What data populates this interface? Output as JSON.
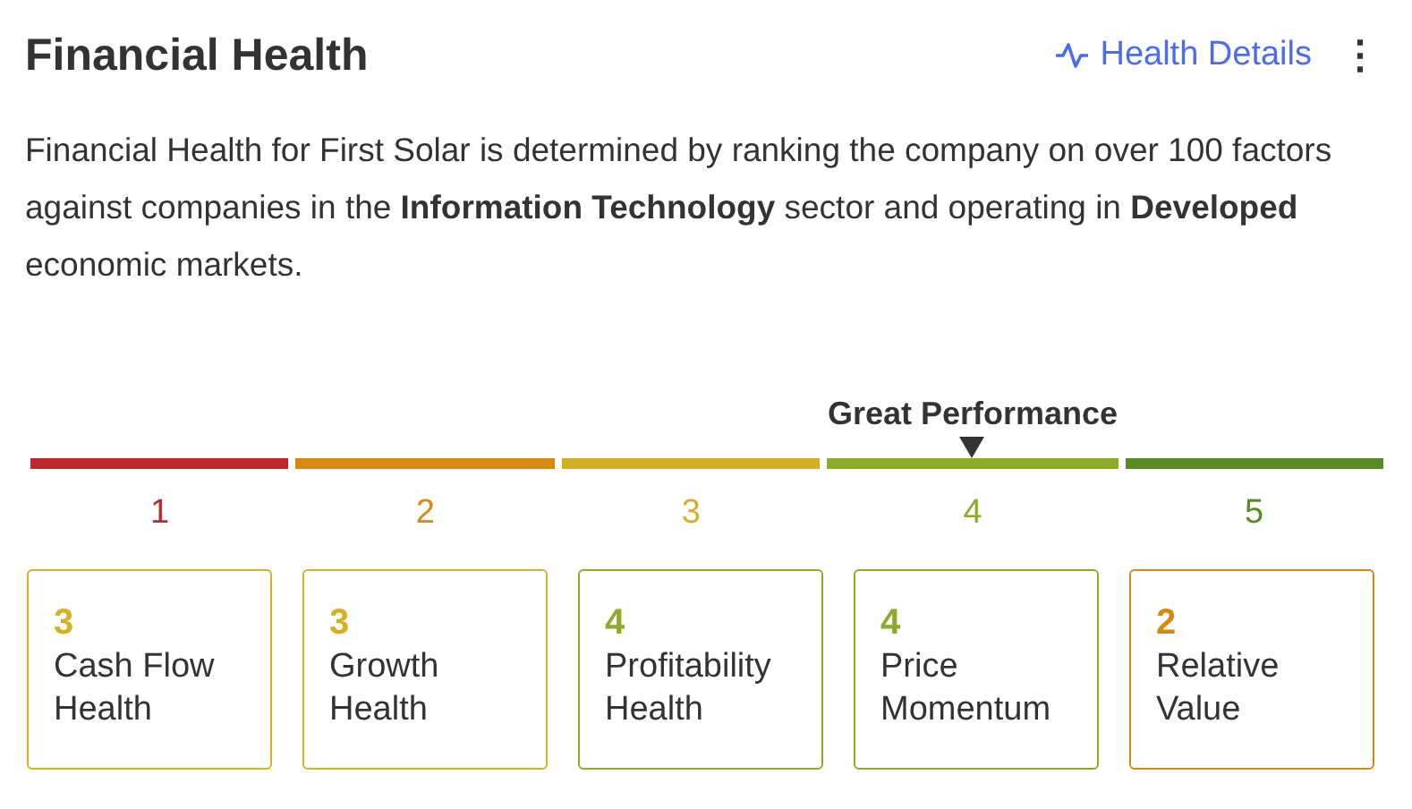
{
  "title": "Financial Health",
  "details_link": "Health Details",
  "menu_icon": "⋮",
  "description": "Financial Health for First Solar is determined by ranking the company on over 100 factors against companies in the **Information Technology** sector and operating in **Developed** economic markets.",
  "scale": [
    {
      "label": "1",
      "selected": false
    },
    {
      "label": "2",
      "selected": false
    },
    {
      "label": "3",
      "selected": false
    },
    {
      "label": "4",
      "selected": true,
      "caption": "Great Performance"
    },
    {
      "label": "5",
      "selected": false
    }
  ],
  "cards": [
    {
      "score": "3",
      "label": "Cash Flow Health"
    },
    {
      "score": "3",
      "label": "Growth Health"
    },
    {
      "score": "4",
      "label": "Profitability Health"
    },
    {
      "score": "4",
      "label": "Price Momentum"
    },
    {
      "score": "2",
      "label": "Relative Value"
    }
  ]
}
